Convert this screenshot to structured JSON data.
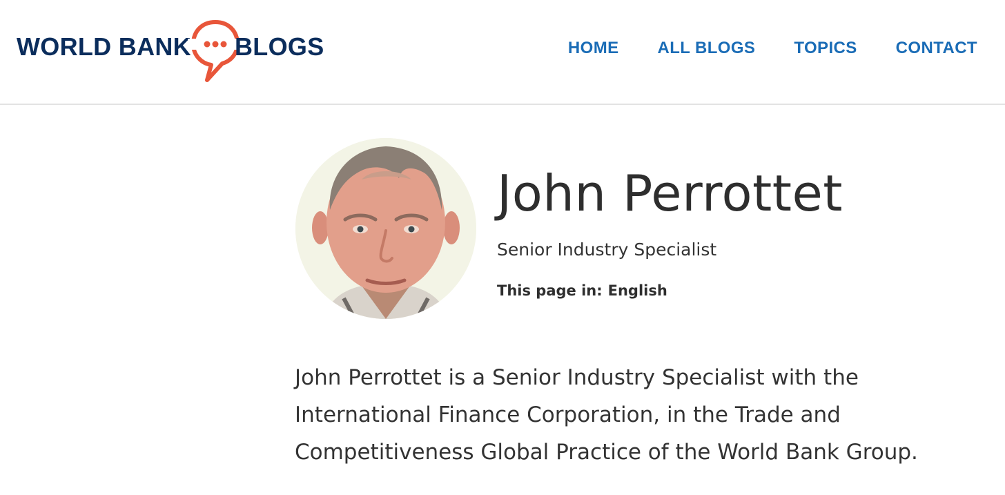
{
  "header": {
    "logo": {
      "left_text": "WORLD BANK",
      "right_text": "BLOGS",
      "bubble_icon": "speech-bubble-icon",
      "brand_color": "#0b2d5c",
      "accent_color": "#e8563a"
    },
    "nav": [
      {
        "label": "HOME"
      },
      {
        "label": "ALL BLOGS"
      },
      {
        "label": "TOPICS"
      },
      {
        "label": "CONTACT"
      }
    ],
    "nav_color": "#1a6cb6"
  },
  "profile": {
    "name": "John Perrottet",
    "role": "Senior Industry Specialist",
    "language_label": "This page in:",
    "language_value": "English"
  },
  "bio": {
    "lines": [
      "John Perrottet is a Senior Industry Specialist with the",
      "International Finance Corporation, in the Trade and",
      "Competitiveness Global Practice of the World Bank Group."
    ]
  }
}
